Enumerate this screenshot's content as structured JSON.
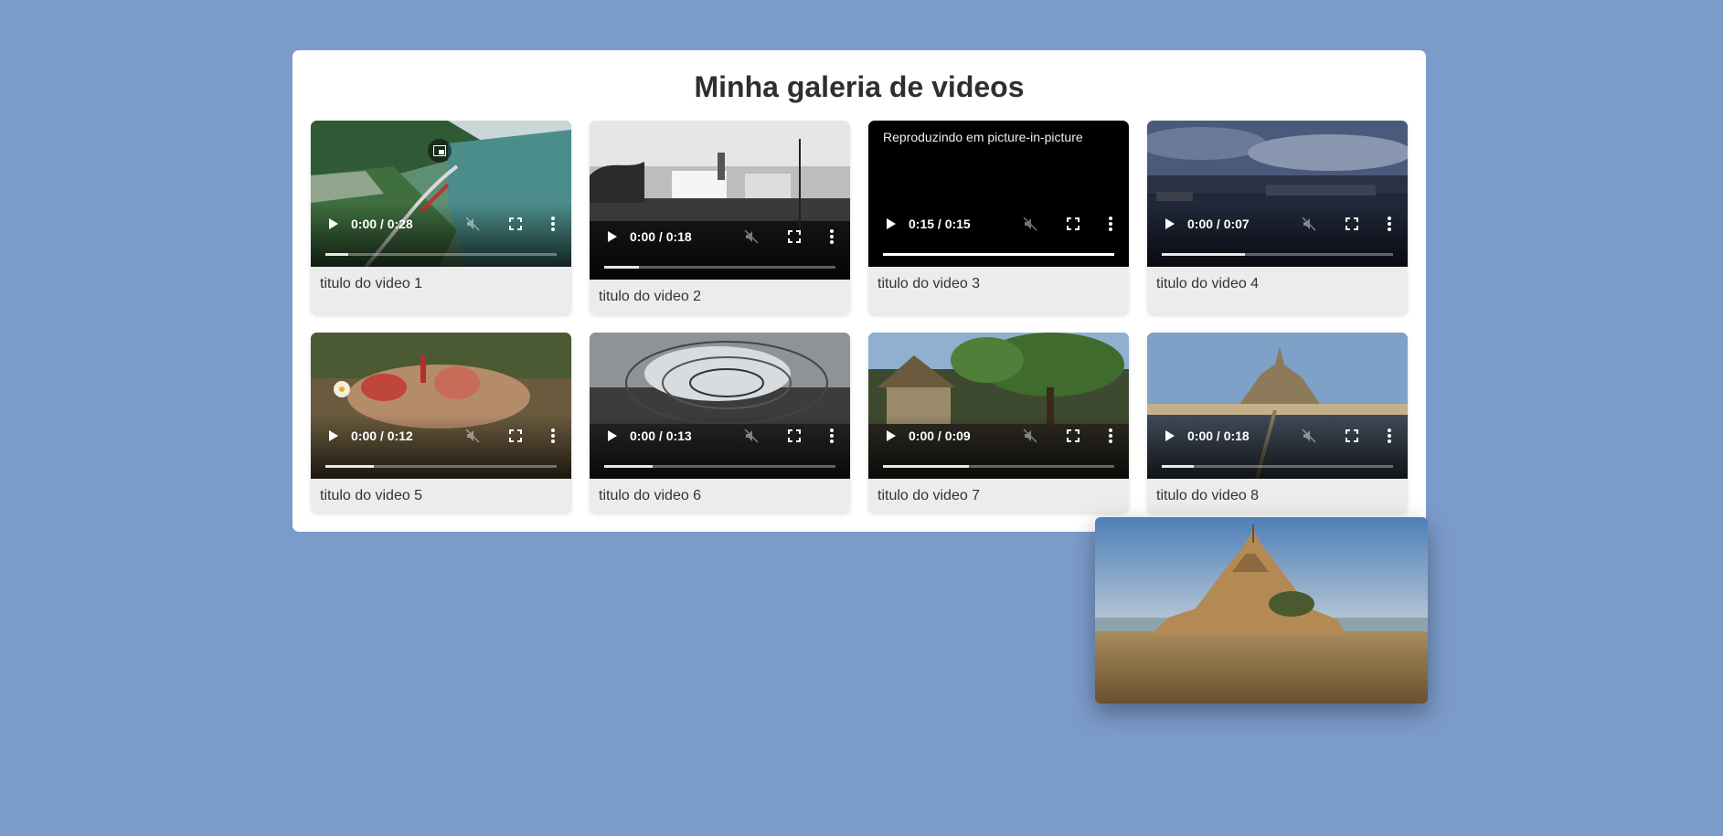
{
  "page": {
    "background": "#7b9bca",
    "title": "Minha galeria de videos"
  },
  "videos": [
    {
      "title": "titulo do video 1",
      "time": "0:00 / 0:28",
      "progress": 0.1,
      "pip_button": true
    },
    {
      "title": "titulo do video 2",
      "time": "0:00 / 0:18",
      "progress": 0.15
    },
    {
      "title": "titulo do video 3",
      "time": "0:15 / 0:15",
      "progress": 1.0,
      "status_text": "Reproduzindo em picture-in-picture"
    },
    {
      "title": "titulo do video 4",
      "time": "0:00 / 0:07",
      "progress": 0.36
    },
    {
      "title": "titulo do video 5",
      "time": "0:00 / 0:12",
      "progress": 0.21
    },
    {
      "title": "titulo do video 6",
      "time": "0:00 / 0:13",
      "progress": 0.21
    },
    {
      "title": "titulo do video 7",
      "time": "0:00 / 0:09",
      "progress": 0.37
    },
    {
      "title": "titulo do video 8",
      "time": "0:00 / 0:18",
      "progress": 0.14
    }
  ],
  "icons": {
    "play": "play-icon",
    "mute": "muted-speaker-icon",
    "fullscreen": "fullscreen-icon",
    "menu": "more-options-icon",
    "pip": "picture-in-picture-icon"
  }
}
